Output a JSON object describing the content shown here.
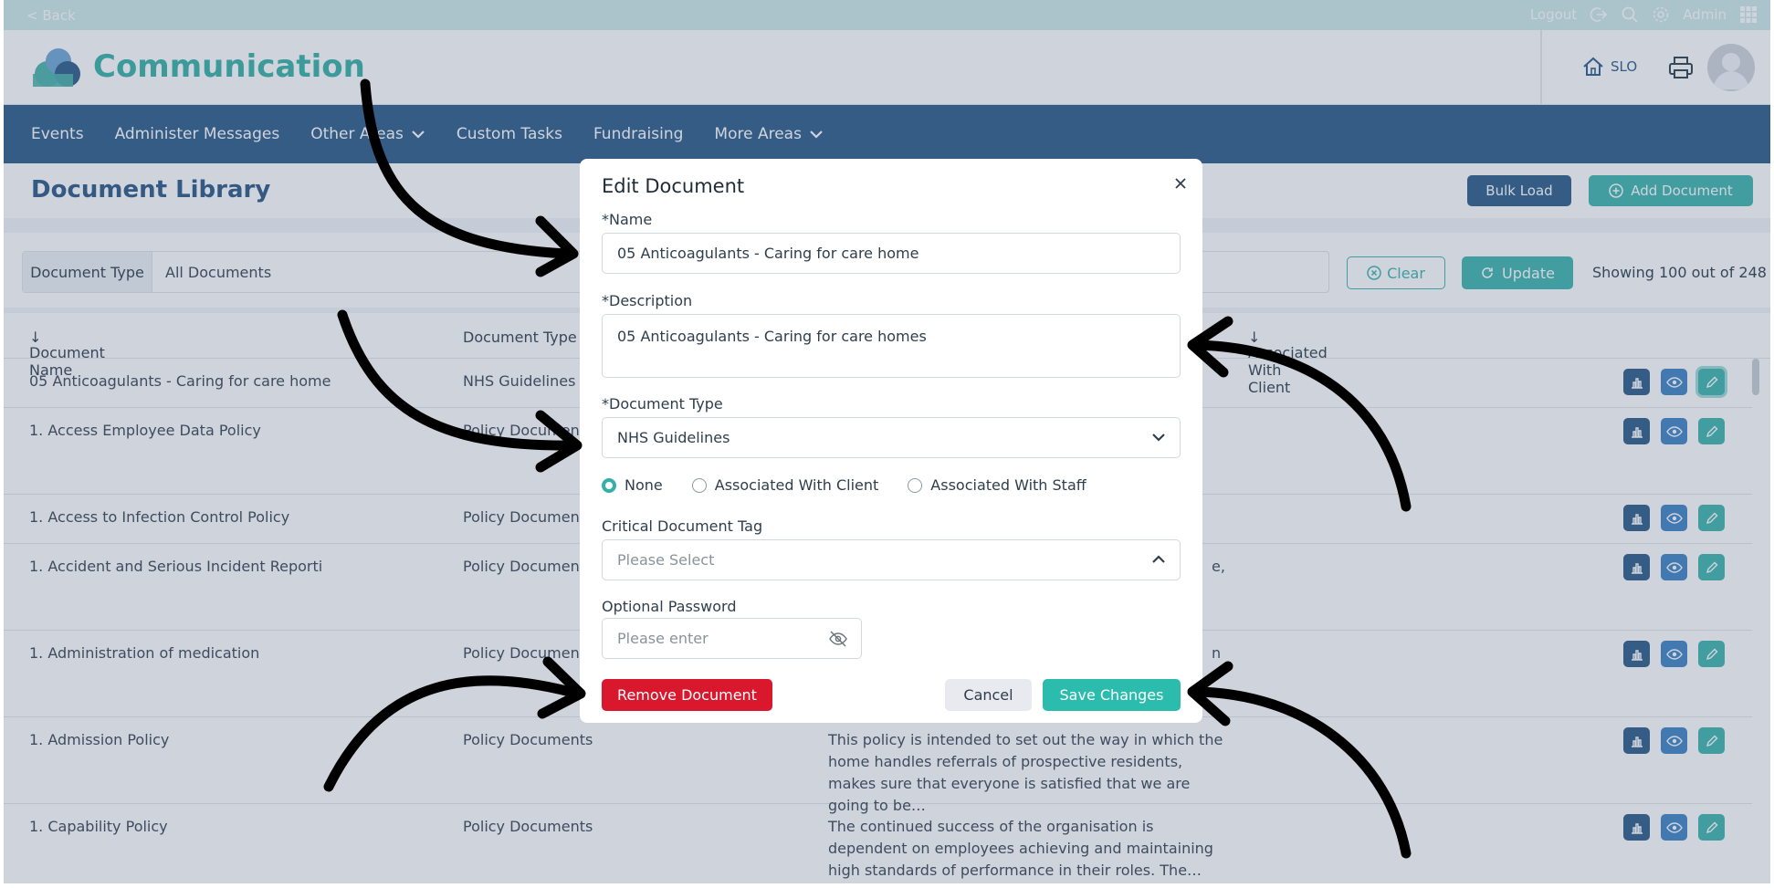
{
  "colors": {
    "teal_accent": "#35b0a6",
    "nav_blue": "#2c5a86",
    "danger_red": "#d9172d",
    "save_teal": "#2bbcad"
  },
  "topbar": {
    "back_label": "< Back",
    "logout_label": "Logout",
    "user_label": "Admin",
    "icons": [
      "logout-icon",
      "search-icon",
      "gear-icon",
      "apps-grid-icon"
    ]
  },
  "header": {
    "app_title": "Communication",
    "home_label": "SLO",
    "icons": [
      "home-icon",
      "printer-icon",
      "user-avatar"
    ]
  },
  "nav": {
    "items": [
      {
        "label": "Events"
      },
      {
        "label": "Administer Messages"
      },
      {
        "label": "Other Areas"
      },
      {
        "label": "Custom Tasks"
      },
      {
        "label": "Fundraising"
      },
      {
        "label": "More Areas"
      }
    ]
  },
  "page": {
    "title": "Document Library",
    "bulk_load_label": "Bulk Load",
    "add_document_label": "Add Document"
  },
  "filter": {
    "type_label": "Document Type",
    "type_value": "All Documents",
    "clear_label": "Clear",
    "update_label": "Update",
    "showing_text": "Showing 100 out of 248"
  },
  "table": {
    "headers": {
      "name": "Document Name",
      "type": "Document Type",
      "assoc": "Associated With Client"
    },
    "rows": [
      {
        "name": "05 Anticoagulants - Caring for care home",
        "type": "NHS Guidelines",
        "desc": "",
        "assoc": ""
      },
      {
        "name": "1. Access Employee Data Policy",
        "type": "Policy Documents",
        "desc": "",
        "assoc": ""
      },
      {
        "name": "1. Access to Infection Control Policy",
        "type": "Policy Documents",
        "desc": "",
        "assoc": ""
      },
      {
        "name": "1. Accident and Serious Incident Reporti",
        "type": "Policy Documents",
        "desc": "",
        "assoc": "e,"
      },
      {
        "name": "1. Administration of medication",
        "type": "Policy Documents",
        "desc": "",
        "assoc": "n"
      },
      {
        "name": "1. Admission Policy",
        "type": "Policy Documents",
        "desc": "This policy is intended to set out the way in which the home handles referrals of prospective residents, makes sure that everyone is satisfied that we are going to be…",
        "assoc": ""
      },
      {
        "name": "1. Capability Policy",
        "type": "Policy Documents",
        "desc": "The continued success of the organisation is dependent on employees achieving and maintaining high standards of performance in their roles. The…",
        "assoc": ""
      }
    ]
  },
  "modal": {
    "title": "Edit Document",
    "name_label": "*Name",
    "name_value": "05 Anticoagulants - Caring for care home",
    "description_label": "*Description",
    "description_value": "05 Anticoagulants - Caring for care homes",
    "doctype_label": "*Document Type",
    "doctype_value": "NHS Guidelines",
    "radio_options": [
      "None",
      "Associated With Client",
      "Associated With Staff"
    ],
    "radio_selected": "None",
    "tag_label": "Critical Document Tag",
    "tag_placeholder": "Please Select",
    "password_label": "Optional Password",
    "password_placeholder": "Please enter",
    "remove_label": "Remove Document",
    "cancel_label": "Cancel",
    "save_label": "Save Changes"
  }
}
